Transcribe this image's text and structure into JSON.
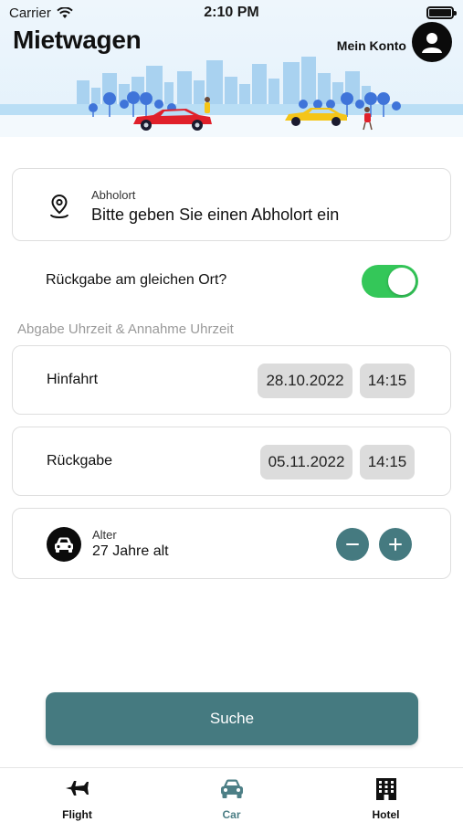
{
  "status_bar": {
    "carrier": "Carrier",
    "time": "2:10 PM"
  },
  "header": {
    "title": "Mietwagen",
    "account_label": "Mein Konto"
  },
  "pickup": {
    "label": "Abholort",
    "placeholder": "Bitte geben Sie einen Abholort ein"
  },
  "same_location": {
    "label": "Rückgabe am gleichen Ort?",
    "enabled": true
  },
  "times_section": {
    "heading": "Abgabe Uhrzeit & Annahme Uhrzeit",
    "outbound": {
      "label": "Hinfahrt",
      "date": "28.10.2022",
      "time": "14:15"
    },
    "return": {
      "label": "Rückgabe",
      "date": "05.11.2022",
      "time": "14:15"
    }
  },
  "age": {
    "label": "Alter",
    "value": "27 Jahre alt"
  },
  "search_button": {
    "label": "Suche"
  },
  "tabs": [
    {
      "label": "Flight",
      "icon": "airplane-icon",
      "active": false
    },
    {
      "label": "Car",
      "icon": "car-icon",
      "active": true
    },
    {
      "label": "Hotel",
      "icon": "hotel-icon",
      "active": false
    }
  ],
  "colors": {
    "accent": "#457a80",
    "toggle_on": "#34c759",
    "active_tab": "#4d7f86",
    "title_highlight": "#f5c518"
  }
}
